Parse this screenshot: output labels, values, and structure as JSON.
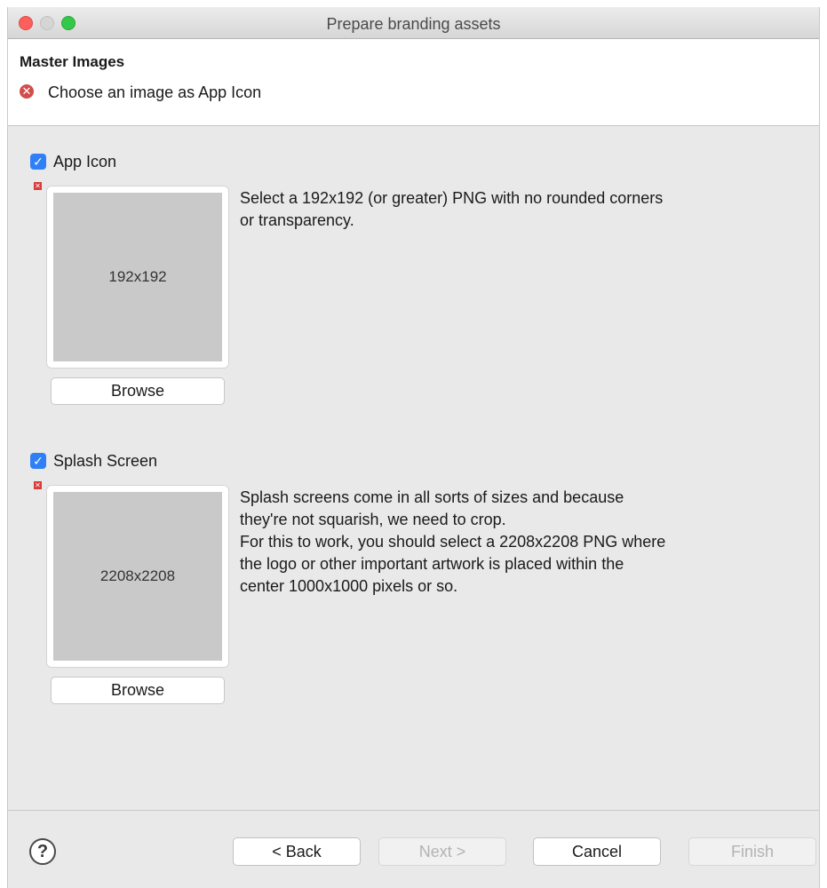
{
  "window": {
    "title": "Prepare branding assets"
  },
  "header": {
    "title": "Master Images",
    "message": "Choose an image as App Icon",
    "error_icon": "error-circle-icon"
  },
  "sections": {
    "app_icon": {
      "checked": true,
      "label": "App Icon",
      "placeholder": "192x192",
      "description": [
        "Select a 192x192 (or greater) PNG with no rounded corners",
        "or transparency."
      ],
      "browse_label": "Browse"
    },
    "splash": {
      "checked": true,
      "label": "Splash Screen",
      "placeholder": "2208x2208",
      "description": [
        "Splash screens come in all sorts of sizes and because",
        "they're not squarish, we need to crop.",
        "For this to work, you should select a 2208x2208 PNG where",
        "the logo or other important artwork is placed within the",
        "center 1000x1000 pixels or so."
      ],
      "browse_label": "Browse"
    }
  },
  "footer": {
    "help_label": "?",
    "back_label": "< Back",
    "next_label": "Next >",
    "cancel_label": "Cancel",
    "finish_label": "Finish"
  },
  "colors": {
    "accent": "#2f7ff6",
    "error": "#d24c4c",
    "panel_bg": "#e9e9e9"
  }
}
